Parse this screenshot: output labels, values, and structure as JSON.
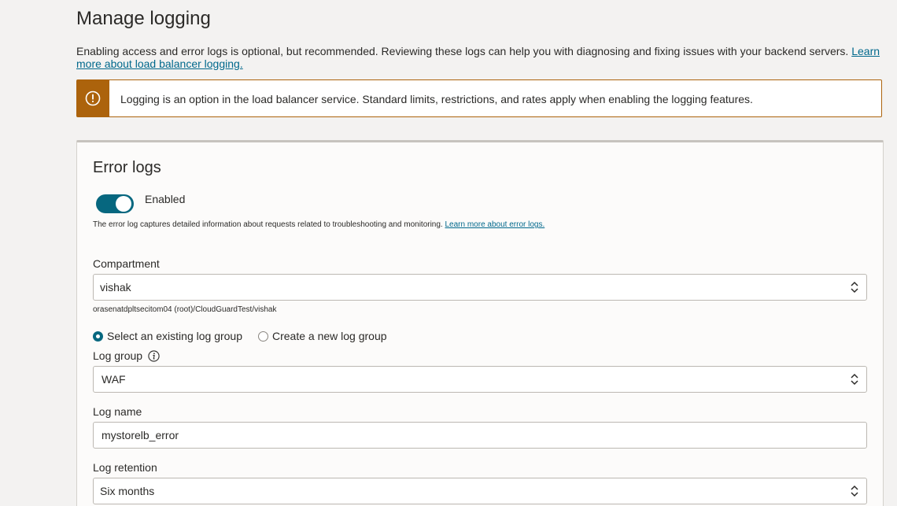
{
  "page": {
    "title": "Manage logging",
    "intro_text": "Enabling access and error logs is optional, but recommended. Reviewing these logs can help you with diagnosing and fixing issues with your backend servers. ",
    "intro_link": "Learn more about load balancer logging."
  },
  "banner": {
    "icon": "warning-icon",
    "text": "Logging is an option in the load balancer service. Standard limits, restrictions, and rates apply when enabling the logging features.",
    "color": "#ac630c"
  },
  "error_logs": {
    "title": "Error logs",
    "toggle_label": "Enabled",
    "toggle_on": true,
    "help_text": "The error log captures detailed information about requests related to troubleshooting and monitoring. ",
    "help_link": "Learn more about error logs.",
    "compartment": {
      "label": "Compartment",
      "value": "vishak",
      "path": "orasenatdpltsecitom04 (root)/CloudGuardTest/vishak"
    },
    "log_group_choice": {
      "options": [
        "Select an existing log group",
        "Create a new log group"
      ],
      "selected": "Select an existing log group"
    },
    "log_group": {
      "label": "Log group",
      "value": "WAF"
    },
    "log_name": {
      "label": "Log name",
      "value": "mystorelb_error"
    },
    "log_retention": {
      "label": "Log retention",
      "value": "Six months"
    }
  },
  "colors": {
    "accent": "#06677f",
    "link": "#00688c",
    "warning": "#ac630c",
    "background": "#f3f2f1"
  }
}
